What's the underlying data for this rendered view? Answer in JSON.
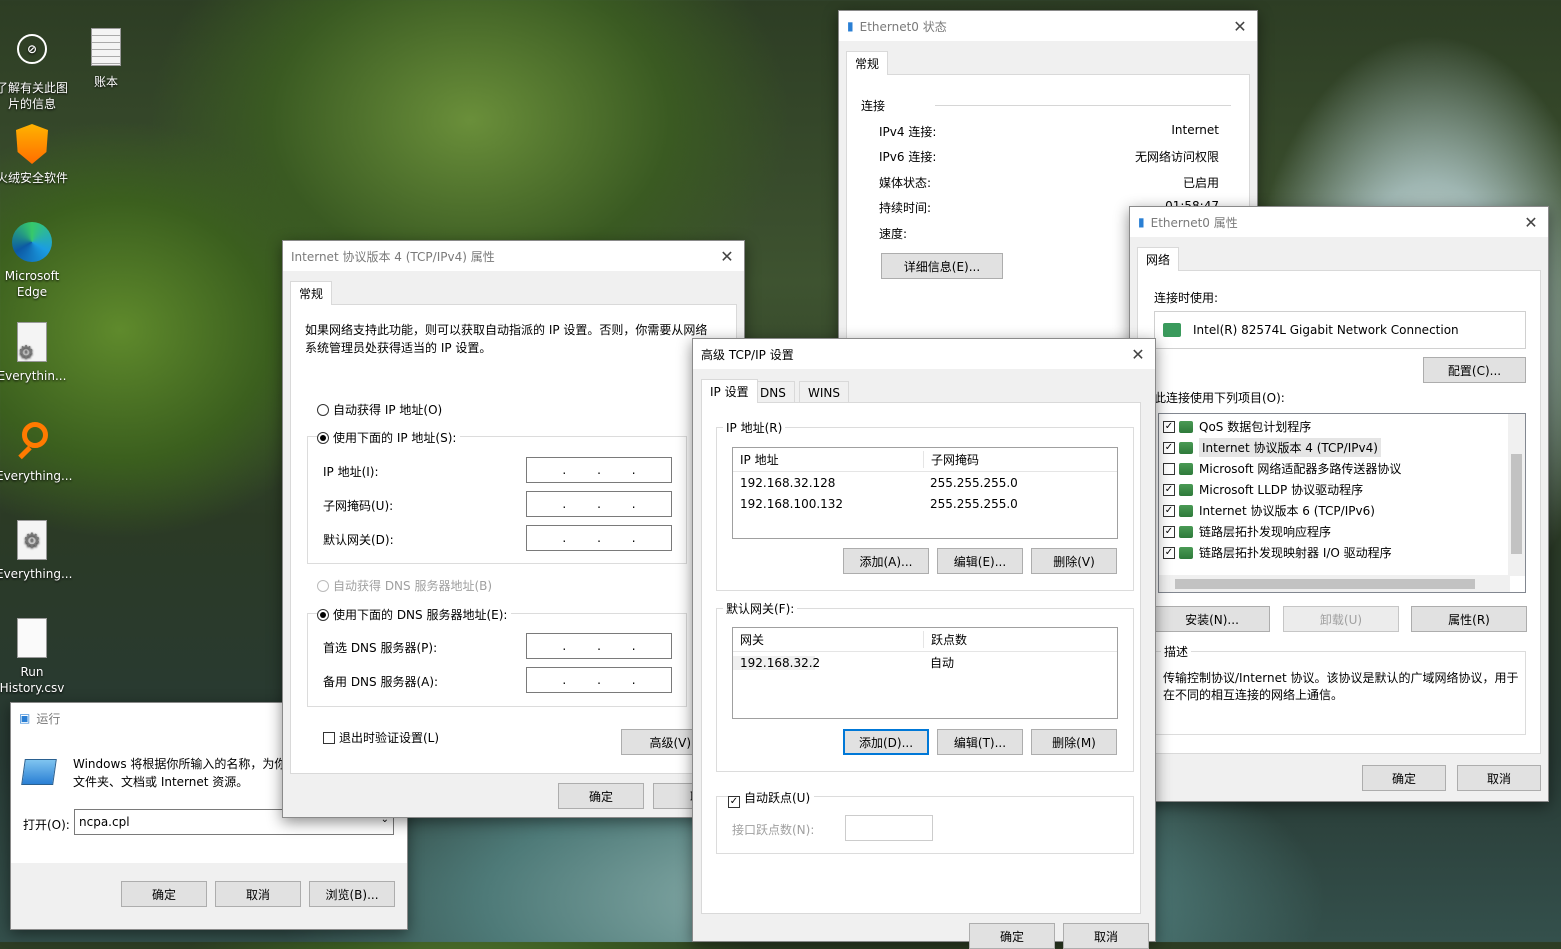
{
  "desktop": {
    "icons": [
      {
        "label": "了解有关此图片的信息",
        "glyph": "info-icon"
      },
      {
        "label": "账本",
        "glyph": "document-icon"
      },
      {
        "label": "火绒安全软件",
        "glyph": "huorong-icon"
      },
      {
        "label": "Microsoft Edge",
        "glyph": "edge-icon"
      },
      {
        "label": "Everythin...",
        "glyph": "settings-file-icon"
      },
      {
        "label": "Everything...",
        "glyph": "everything-icon"
      },
      {
        "label": "Everything...",
        "glyph": "settings-file-icon"
      },
      {
        "label": "Run History.csv",
        "glyph": "file-icon"
      }
    ]
  },
  "eth_status": {
    "title": "Ethernet0 状态",
    "tab": "常规",
    "section": "连接",
    "rows": [
      {
        "k": "IPv4 连接:",
        "v": "Internet"
      },
      {
        "k": "IPv6 连接:",
        "v": "无网络访问权限"
      },
      {
        "k": "媒体状态:",
        "v": "已启用"
      },
      {
        "k": "持续时间:",
        "v": "01:58:47"
      },
      {
        "k": "速度:",
        "v": ""
      }
    ],
    "details_button": "详细信息(E)..."
  },
  "eth_props": {
    "title": "Ethernet0 属性",
    "tab": "网络",
    "connect_using": "连接时使用:",
    "adapter": "Intel(R) 82574L Gigabit Network Connection",
    "configure": "配置(C)...",
    "items_label": "此连接使用下列项目(O):",
    "items": [
      {
        "checked": true,
        "label": "QoS 数据包计划程序"
      },
      {
        "checked": true,
        "label": "Internet 协议版本 4 (TCP/IPv4)",
        "selected": true
      },
      {
        "checked": false,
        "label": "Microsoft 网络适配器多路传送器协议"
      },
      {
        "checked": true,
        "label": "Microsoft LLDP 协议驱动程序"
      },
      {
        "checked": true,
        "label": "Internet 协议版本 6 (TCP/IPv6)"
      },
      {
        "checked": true,
        "label": "链路层拓扑发现响应程序"
      },
      {
        "checked": true,
        "label": "链路层拓扑发现映射器 I/O 驱动程序"
      }
    ],
    "install": "安装(N)...",
    "uninstall": "卸载(U)",
    "properties": "属性(R)",
    "desc_title": "描述",
    "desc": "传输控制协议/Internet 协议。该协议是默认的广域网络协议，用于在不同的相互连接的网络上通信。",
    "ok": "确定",
    "cancel": "取消"
  },
  "ipv4": {
    "title": "Internet 协议版本 4 (TCP/IPv4) 属性",
    "tab": "常规",
    "intro": "如果网络支持此功能，则可以获取自动指派的 IP 设置。否则，你需要从网络系统管理员处获得适当的 IP 设置。",
    "auto_ip": "自动获得 IP 地址(O)",
    "manual_ip": "使用下面的 IP 地址(S):",
    "ip_label": "IP 地址(I):",
    "mask_label": "子网掩码(U):",
    "gw_label": "默认网关(D):",
    "auto_dns": "自动获得 DNS 服务器地址(B)",
    "manual_dns": "使用下面的 DNS 服务器地址(E):",
    "pref_dns": "首选 DNS 服务器(P):",
    "alt_dns": "备用 DNS 服务器(A):",
    "validate": "退出时验证设置(L)",
    "advanced": "高级(V)...",
    "ok": "确定",
    "cancel": "取"
  },
  "advanced": {
    "title": "高级 TCP/IP 设置",
    "tabs": [
      "IP 设置",
      "DNS",
      "WINS"
    ],
    "ip_group": "IP 地址(R)",
    "ip_cols": [
      "IP 地址",
      "子网掩码"
    ],
    "ip_rows": [
      [
        "192.168.32.128",
        "255.255.255.0"
      ],
      [
        "192.168.100.132",
        "255.255.255.0"
      ]
    ],
    "add1": "添加(A)...",
    "edit1": "编辑(E)...",
    "del1": "删除(V)",
    "gw_group": "默认网关(F):",
    "gw_cols": [
      "网关",
      "跃点数"
    ],
    "gw_rows": [
      [
        "192.168.32.2",
        "自动"
      ]
    ],
    "add2": "添加(D)...",
    "edit2": "编辑(T)...",
    "del2": "删除(M)",
    "auto_metric": "自动跃点(U)",
    "iface_metric": "接口跃点数(N):",
    "ok": "确定",
    "cancel": "取消"
  },
  "run": {
    "title": "运行",
    "desc": "Windows 将根据你所输入的名称，为你打开相应的程序、文件夹、文档或 Internet 资源。",
    "desc_visible": "Windows 将根据你所输入的名称，为你",
    "desc2": "文件夹、文档或 Internet 资源。",
    "open_label": "打开(O):",
    "value": "ncpa.cpl",
    "ok": "确定",
    "cancel": "取消",
    "browse": "浏览(B)..."
  }
}
